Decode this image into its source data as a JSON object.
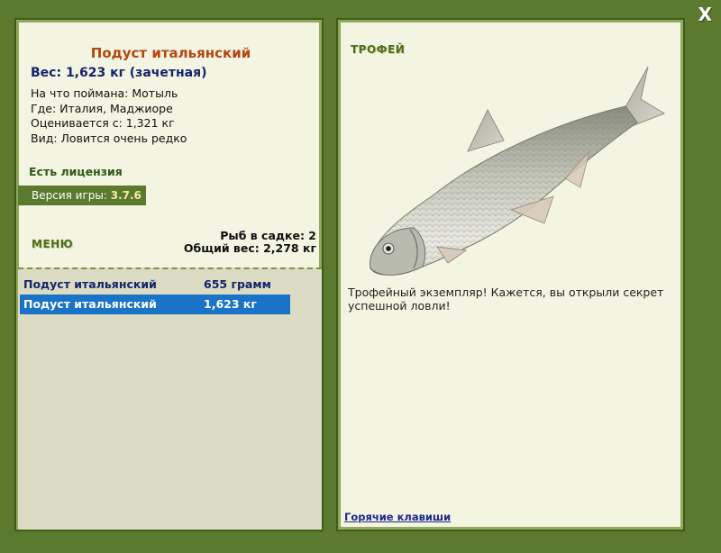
{
  "close_label": "X",
  "fish": {
    "name": "Подуст итальянский",
    "weight_line": "Вес: 1,623 кг (зачетная)",
    "info": [
      "На что поймана: Мотыль",
      "Где: Италия, Маджиоре",
      "Оценивается с: 1,321 кг",
      "Вид: Ловится очень редко"
    ]
  },
  "license_label": "Есть лицензия",
  "version": {
    "label": "Версия игры: ",
    "value": "3.7.6"
  },
  "menu_label": "МЕНЮ",
  "keepnet": {
    "count_line": "Рыб в садке: 2",
    "total_line": "Общий вес: 2,278 кг"
  },
  "catch_list": [
    {
      "name": "Подуст итальянский",
      "weight": "655 грамм",
      "selected": false
    },
    {
      "name": "Подуст итальянский",
      "weight": "1,623 кг",
      "selected": true
    }
  ],
  "trophy": {
    "label": "ТРОФЕЙ",
    "text": "Трофейный экземпляр! Кажется, вы открыли секрет успешной ловли!"
  },
  "hotkeys_label": "Горячие клавиши",
  "colors": {
    "frame": "#5b7a2e",
    "panel": "#f4f4e2",
    "title": "#b3450f",
    "selected_row": "#1b73c8"
  }
}
